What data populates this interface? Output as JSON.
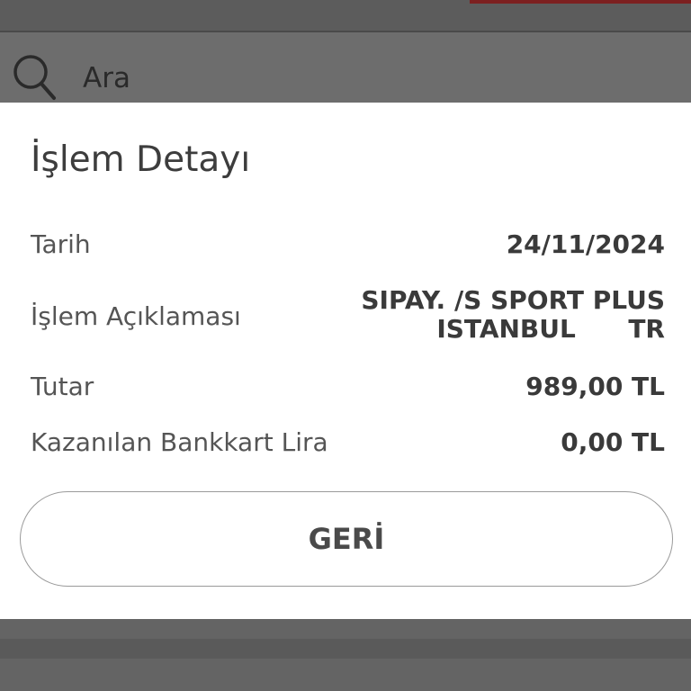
{
  "background": {
    "search": {
      "icon": "search-icon",
      "label": "Ara"
    },
    "accent_color": "#7c2020"
  },
  "modal": {
    "title": "İşlem Detayı",
    "rows": [
      {
        "label": "Tarih",
        "value_lines": [
          "24/11/2024"
        ]
      },
      {
        "label": "İşlem Açıklaması",
        "value_lines": [
          "SIPAY. /S SPORT PLUS",
          "ISTANBUL      TR"
        ]
      },
      {
        "label": "Tutar",
        "value_lines": [
          "989,00 TL"
        ]
      },
      {
        "label": "Kazanılan Bankkart Lira",
        "value_lines": [
          "0,00 TL"
        ]
      }
    ],
    "back_button_label": "GERİ"
  }
}
